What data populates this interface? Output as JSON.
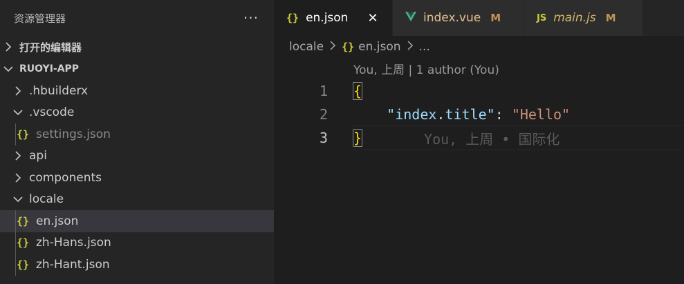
{
  "sidebar": {
    "title": "资源管理器",
    "more": "···",
    "open_editors": "打开的编辑器",
    "project": "RUOYI-APP",
    "items": [
      {
        "label": ".hbuilderx",
        "type": "folder",
        "expanded": false
      },
      {
        "label": ".vscode",
        "type": "folder",
        "expanded": true
      },
      {
        "label": "settings.json",
        "type": "json",
        "icon": "{}"
      },
      {
        "label": "api",
        "type": "folder",
        "expanded": false
      },
      {
        "label": "components",
        "type": "folder",
        "expanded": false
      },
      {
        "label": "locale",
        "type": "folder",
        "expanded": true
      },
      {
        "label": "en.json",
        "type": "json",
        "icon": "{}"
      },
      {
        "label": "zh-Hans.json",
        "type": "json",
        "icon": "{}"
      },
      {
        "label": "zh-Hant.json",
        "type": "json",
        "icon": "{}"
      }
    ]
  },
  "tabs": [
    {
      "label": "en.json",
      "icon": "{}",
      "close": "✕"
    },
    {
      "label": "index.vue",
      "modified": "M"
    },
    {
      "label": "main.js",
      "icon": "JS",
      "modified": "M"
    }
  ],
  "breadcrumb": {
    "folder": "locale",
    "file": "en.json",
    "rest": "..."
  },
  "codelens": "You, 上周 | 1 author (You)",
  "code": {
    "line_numbers": [
      "1",
      "2",
      "3"
    ],
    "open_brace": "{",
    "key": "\"index.title\"",
    "colon": ": ",
    "value": "\"Hello\"",
    "close_brace": "}",
    "blame": "You, 上周 • 国际化"
  },
  "colors": {
    "accent_json": "#cbcb41",
    "vue": "#41b883",
    "modified": "#c09553"
  }
}
